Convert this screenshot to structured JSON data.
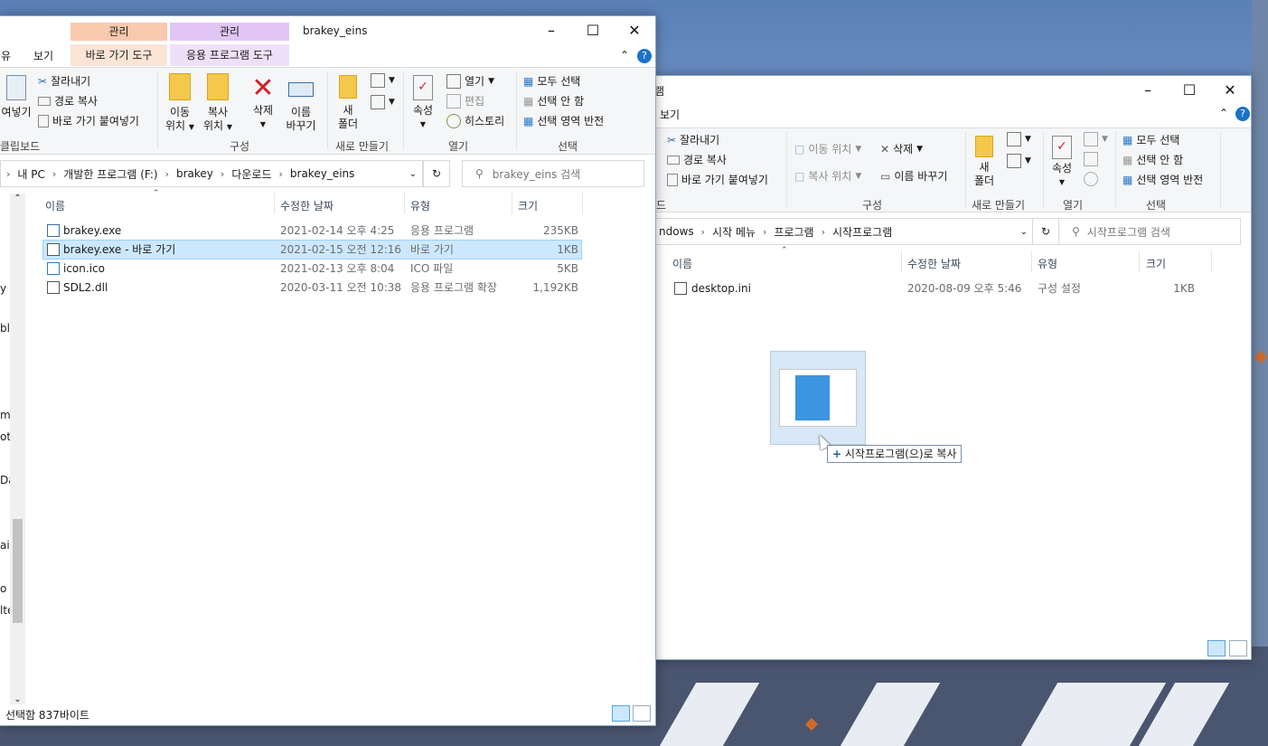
{
  "left": {
    "title": "brakey_eins",
    "context_tabs": [
      {
        "group": "관리",
        "tab": "바로 가기 도구",
        "color": "#f9c9ae"
      },
      {
        "group": "관리",
        "tab": "응용 프로그램 도구",
        "color": "#e1c6f5"
      }
    ],
    "menu_tabs": [
      "유",
      "보기"
    ],
    "clipboard": {
      "paste_partial": "여넣기",
      "cut": "잘라내기",
      "copy_path": "경로 복사",
      "paste_shortcut": "바로 가기 붙여넣기",
      "label": "클립보드"
    },
    "organize": {
      "move_to": "이동",
      "move_to2": "위치",
      "copy_to": "복사",
      "copy_to2": "위치",
      "delete": "삭제",
      "rename": "이름",
      "rename2": "바꾸기",
      "label": "구성"
    },
    "new": {
      "folder": "새",
      "folder2": "폴더",
      "label": "새로 만들기"
    },
    "open": {
      "properties": "속성",
      "open": "열기",
      "edit": "편집",
      "history": "히스토리",
      "label": "열기"
    },
    "select": {
      "all": "모두 선택",
      "none": "선택 안 함",
      "invert": "선택 영역 반전",
      "label": "선택"
    },
    "breadcrumb": [
      "내 PC",
      "개발한 프로그램 (F:)",
      "brakey",
      "다운로드",
      "brakey_eins"
    ],
    "search_placeholder": "brakey_eins 검색",
    "columns": [
      "이름",
      "수정한 날짜",
      "유형",
      "크기"
    ],
    "files": [
      {
        "name": "brakey.exe",
        "date": "2021-02-14 오후 4:25",
        "type": "응용 프로그램",
        "size": "235KB"
      },
      {
        "name": "brakey.exe - 바로 가기",
        "date": "2021-02-15 오전 12:16",
        "type": "바로 가기",
        "size": "1KB"
      },
      {
        "name": "icon.ico",
        "date": "2021-02-13 오후 8:04",
        "type": "ICO 파일",
        "size": "5KB"
      },
      {
        "name": "SDL2.dll",
        "date": "2020-03-11 오전 10:38",
        "type": "응용 프로그램 확장",
        "size": "1,192KB"
      }
    ],
    "nav_fragments": [
      "y",
      "bl",
      "m",
      "ots",
      "Dat",
      "ain",
      "o 2",
      "lte"
    ],
    "status": "선택함 837바이트"
  },
  "right": {
    "title_fragment": "램",
    "menu_tab": "보기",
    "clipboard": {
      "cut": "잘라내기",
      "copy_path": "경로 복사",
      "paste_shortcut": "바로 가기 붙여넣기",
      "label_fragment": "드"
    },
    "organize": {
      "move_to": "이동 위치",
      "copy_to": "복사 위치",
      "delete": "삭제",
      "rename": "이름 바꾸기",
      "label": "구성"
    },
    "new": {
      "folder": "새",
      "folder2": "폴더",
      "label": "새로 만들기"
    },
    "open": {
      "properties": "속성",
      "label": "열기"
    },
    "select": {
      "all": "모두 선택",
      "none": "선택 안 함",
      "invert": "선택 영역 반전",
      "label": "선택"
    },
    "breadcrumb": [
      "ndows",
      "시작 메뉴",
      "프로그램",
      "시작프로그램"
    ],
    "search_placeholder": "시작프로그램 검색",
    "columns": [
      "이름",
      "수정한 날짜",
      "유형",
      "크기"
    ],
    "files": [
      {
        "name": "desktop.ini",
        "date": "2020-08-09 오후 5:46",
        "type": "구성 설정",
        "size": "1KB"
      }
    ]
  },
  "drag": {
    "tooltip": "시작프로그램(으)로 복사",
    "plus": "+"
  }
}
